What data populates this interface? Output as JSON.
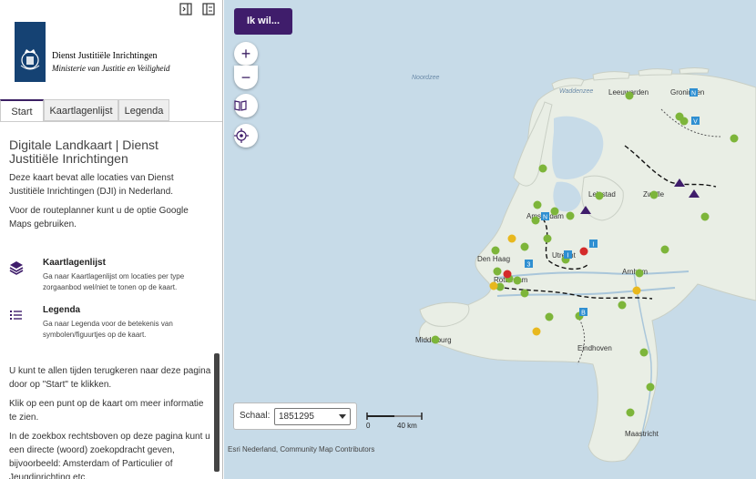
{
  "sidebar": {
    "org_name": "Dienst Justitiële Inrichtingen",
    "org_sub": "Ministerie van Justitie en Veiligheid",
    "tabs": [
      {
        "label": "Start"
      },
      {
        "label": "Kaartlagenlijst"
      },
      {
        "label": "Legenda"
      }
    ],
    "title": "Digitale Landkaart | Dienst Justitiële Inrichtingen",
    "intro1": "Deze kaart bevat alle locaties van Dienst Justitiële Inrichtingen (DJI) in Nederland.",
    "intro2": "Voor de routeplanner kunt u de optie Google Maps gebruiken.",
    "feature1_title": "Kaartlagenlijst",
    "feature1_desc": "Ga naar Kaartlagenlijst om locaties per type zorgaanbod wel/niet te tonen op de kaart.",
    "feature2_title": "Legenda",
    "feature2_desc": "Ga naar Legenda voor de betekenis van symbolen/figuurtjes op de kaart.",
    "lower1": "U kunt te allen tijden terugkeren naar deze pagina door op \"Start\" te klikken.",
    "lower2": "Klik op een punt op de kaart om meer informatie te zien.",
    "lower3": "In de zoekbox rechtsboven op deze pagina kunt u een directe (woord) zoekopdracht geven, bijvoorbeeld: Amsterdam of Particulier of Jeugdinrichting etc."
  },
  "map": {
    "ikwil_label": "Ik wil...",
    "zoom_in": "+",
    "zoom_out": "−",
    "scale_label": "Schaal:",
    "scale_value": "1851295",
    "scalebar_start": "0",
    "scalebar_end": "40 km",
    "attribution": "Esri Nederland, Community Map Contributors",
    "sea_labels": [
      "Noordzee",
      "Waddenzee"
    ],
    "places": [
      "Leeuwarden",
      "Groningen",
      "Amsterdam",
      "Den Haag",
      "Rotterdam",
      "Utrecht",
      "Arnhem",
      "Lelystad",
      "Zwolle",
      "Middelburg",
      "Eindhoven",
      "Maastricht"
    ],
    "colors": {
      "land": "#e9eee5",
      "sea": "#c7dbe8",
      "green": "#7db53a",
      "yellow": "#e8b81e",
      "red": "#d42a2a",
      "blue": "#2f8fd1",
      "purple": "#3f1d6b"
    }
  }
}
